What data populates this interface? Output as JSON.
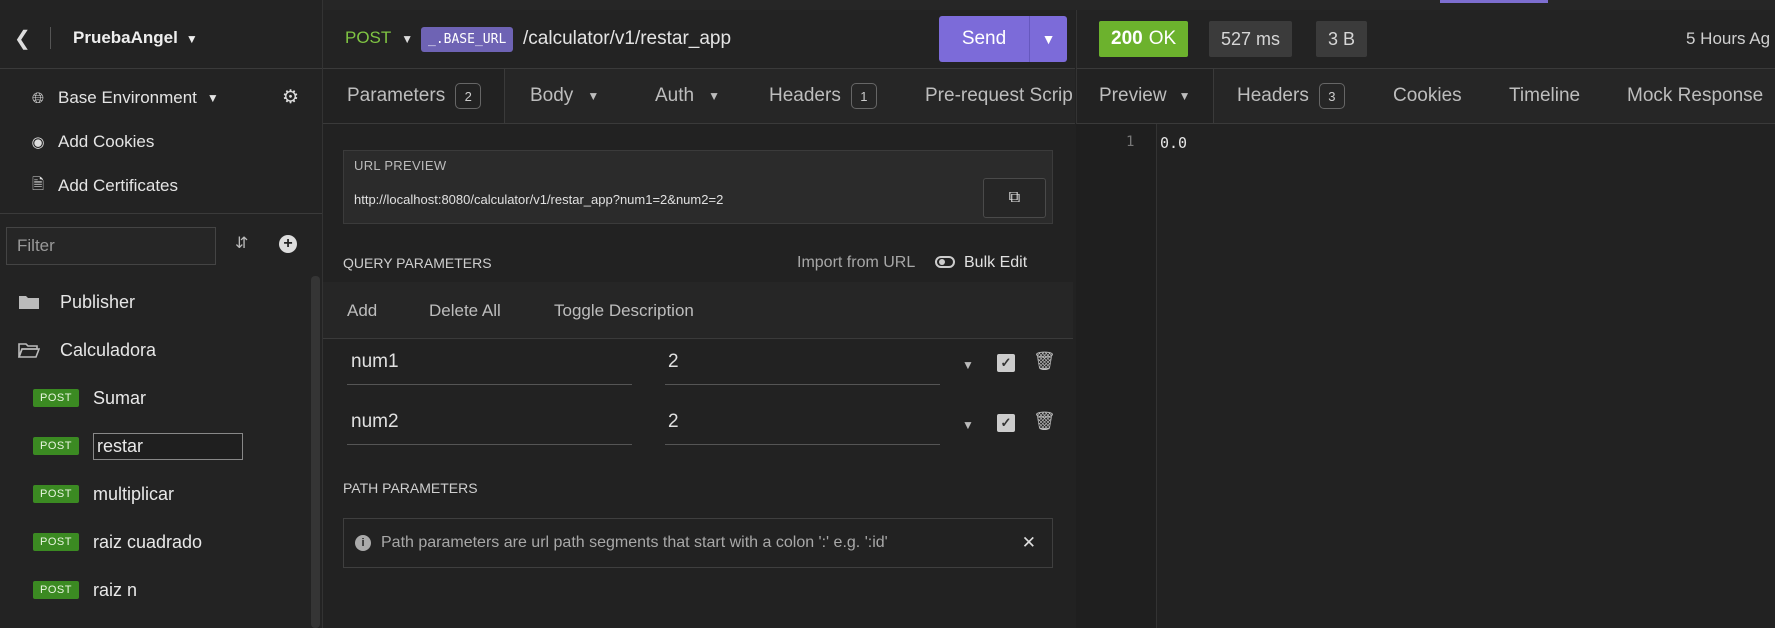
{
  "sidebar": {
    "project": "PruebaAngel",
    "environment": "Base Environment",
    "add_cookies": "Add Cookies",
    "add_certificates": "Add Certificates",
    "filter_placeholder": "Filter",
    "folders": [
      {
        "name": "Publisher",
        "icon": "folder-icon"
      },
      {
        "name": "Calculadora",
        "icon": "folder-open-icon"
      }
    ],
    "requests": [
      {
        "method": "POST",
        "name": "Sumar"
      },
      {
        "method": "POST",
        "name": "restar"
      },
      {
        "method": "POST",
        "name": "multiplicar"
      },
      {
        "method": "POST",
        "name": "raiz cuadrado"
      },
      {
        "method": "POST",
        "name": "raiz n"
      }
    ]
  },
  "request": {
    "method": "POST",
    "base_url_tag": "_.BASE_URL",
    "path": "/calculator/v1/restar_app",
    "send_label": "Send",
    "tabs": [
      {
        "label": "Parameters",
        "count": "2"
      },
      {
        "label": "Body"
      },
      {
        "label": "Auth"
      },
      {
        "label": "Headers",
        "count": "1"
      },
      {
        "label": "Pre-request Scrip"
      }
    ],
    "url_preview_label": "URL PREVIEW",
    "url_preview": "http://localhost:8080/calculator/v1/restar_app?num1=2&num2=2",
    "query_label": "QUERY PARAMETERS",
    "import_from_url": "Import from URL",
    "bulk_edit": "Bulk Edit",
    "query_tools": [
      "Add",
      "Delete All",
      "Toggle Description"
    ],
    "params": [
      {
        "name": "num1",
        "value": "2"
      },
      {
        "name": "num2",
        "value": "2"
      }
    ],
    "path_label": "PATH PARAMETERS",
    "path_info": "Path parameters are url path segments that start with a colon ':' e.g. ':id'"
  },
  "response": {
    "status_code": "200",
    "status_text": "OK",
    "time": "527 ms",
    "size": "3 B",
    "ago": "5 Hours Ag",
    "tabs": [
      {
        "label": "Preview"
      },
      {
        "label": "Headers",
        "count": "3"
      },
      {
        "label": "Cookies"
      },
      {
        "label": "Timeline"
      },
      {
        "label": "Mock Response"
      }
    ],
    "line_number": "1",
    "body": "0.0"
  },
  "colors": {
    "accent": "#7c6bd9",
    "post_badge": "#3b8a22",
    "status_ok": "#6cb22d"
  }
}
